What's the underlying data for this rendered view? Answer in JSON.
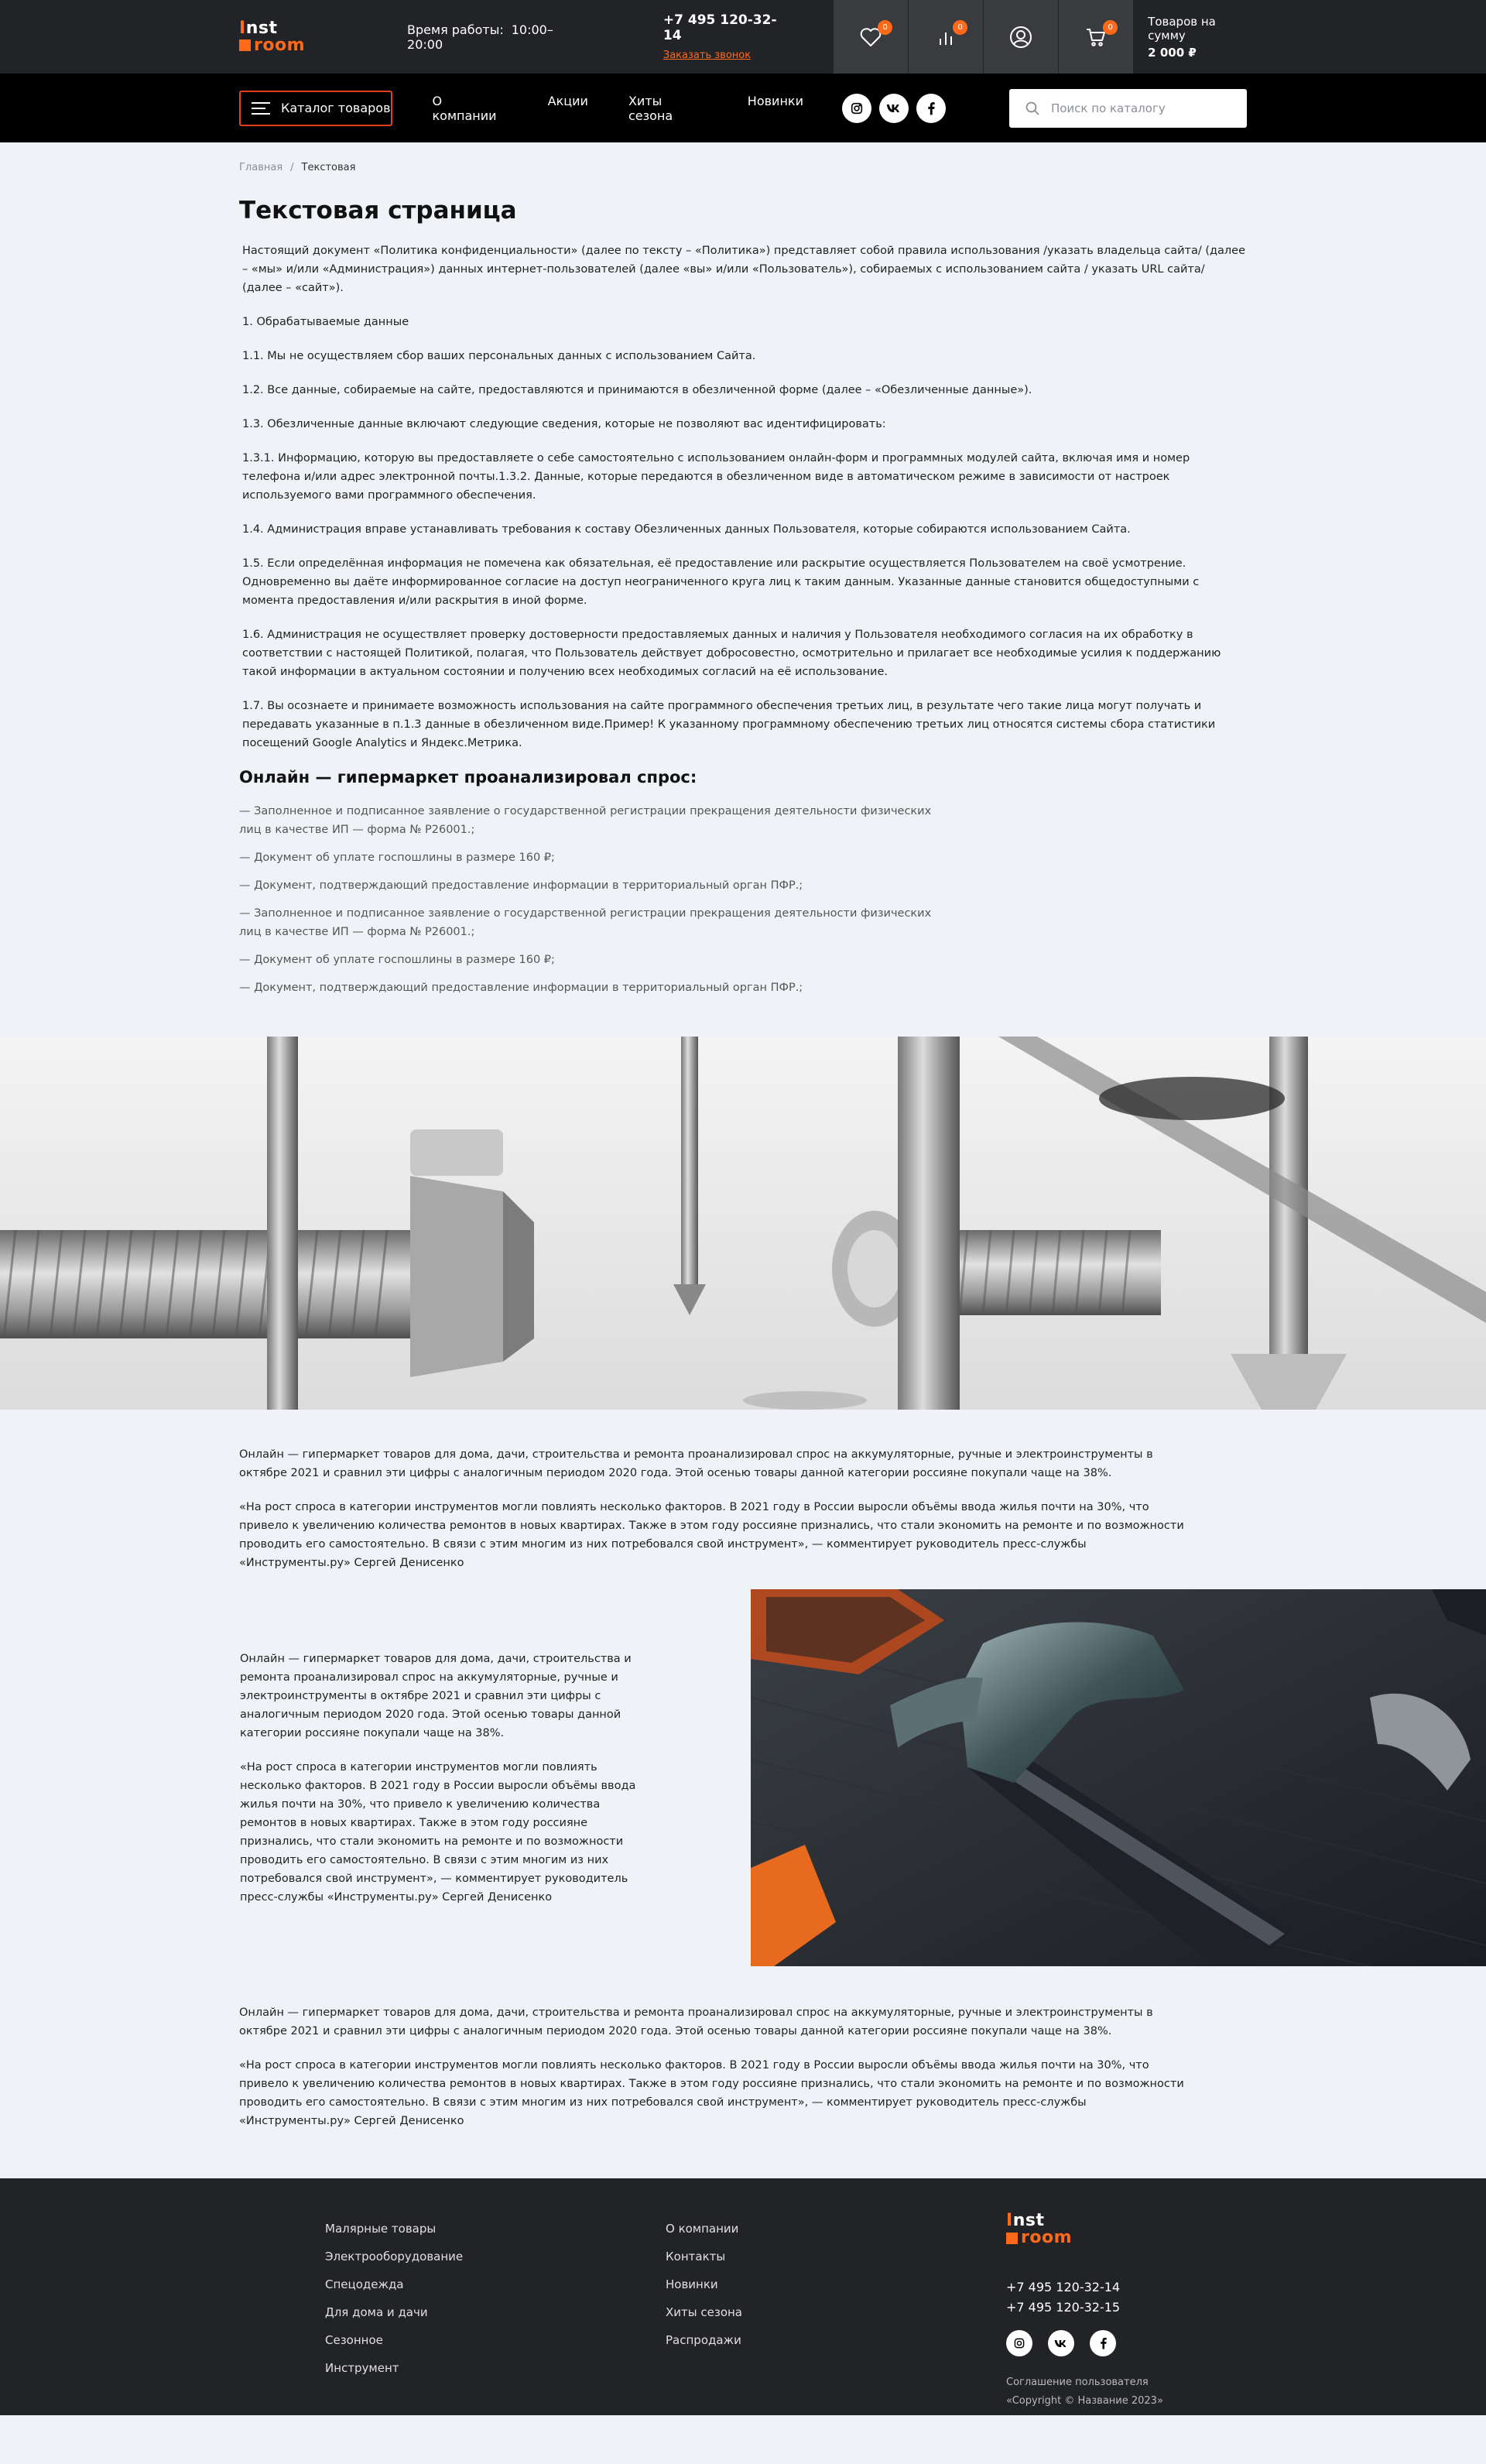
{
  "header": {
    "logo": {
      "line1_mark": "I",
      "line1_rest": "nst",
      "line2": "room"
    },
    "hours_label": "Время работы:",
    "hours_value": "10:00–20:00",
    "phone": "+7 495 120-32-14",
    "callback": "Заказать звонок",
    "badges": {
      "favorites": "0",
      "compare": "0",
      "cart": "0"
    },
    "cart_label": "Товаров на сумму",
    "cart_sum": "2 000 ₽"
  },
  "nav": {
    "catalog": "Каталог товаров",
    "links": [
      "О компании",
      "Акции",
      "Хиты сезона",
      "Новинки"
    ],
    "socials": [
      "instagram-icon",
      "vk-icon",
      "facebook-icon"
    ],
    "search_placeholder": "Поиск по каталогу"
  },
  "breadcrumb": {
    "home": "Главная",
    "sep": "/",
    "current": "Текстовая"
  },
  "page_title": "Текстовая страница",
  "article": {
    "paragraphs": [
      "Настоящий документ «Политика конфиденциальности» (далее по тексту – «Политика») представляет собой правила использования /указать владельца сайта/ (далее – «мы» и/или «Администрация») данных интернет-пользователей (далее «вы» и/или «Пользователь»), собираемых с использованием сайта / указать URL сайта/ (далее – «сайт»).",
      "1. Обрабатываемые данные",
      "1.1. Мы не осуществляем сбор ваших персональных данных с использованием Сайта.",
      "1.2. Все данные, собираемые на сайте, предоставляются и принимаются в обезличенной форме (далее – «Обезличенные данные»).",
      "1.3. Обезличенные данные включают следующие сведения, которые не позволяют вас идентифицировать:",
      "1.3.1. Информацию, которую вы предоставляете о себе самостоятельно с использованием онлайн-форм и программных модулей сайта, включая имя и номер телефона и/или адрес электронной почты.1.3.2. Данные, которые передаются в обезличенном виде в автоматическом режиме в зависимости от настроек используемого вами программного обеспечения.",
      "1.4. Администрация вправе устанавливать требования к составу Обезличенных данных Пользователя, которые собираются использованием Сайта.",
      "1.5. Если определённая информация не помечена как обязательная, её предоставление или раскрытие осуществляется Пользователем на своё усмотрение. Одновременно вы даёте информированное согласие на доступ неограниченного круга лиц к таким данным. Указанные данные становится общедоступными с момента предоставления и/или раскрытия в иной форме.",
      "1.6. Администрация не осуществляет проверку достоверности предоставляемых данных и наличия у Пользователя необходимого согласия на их обработку в соответствии с настоящей Политикой, полагая, что Пользователь действует добросовестно, осмотрительно и прилагает все необходимые усилия к поддержанию такой информации в актуальном состоянии и получению всех необходимых согласий на её использование.",
      "1.7. Вы осознаете и принимаете возможность использования на сайте программного обеспечения третьих лиц, в результате чего такие лица могут получать и передавать указанные в п.1.3 данные в обезличенном виде.Пример! К указанному программному обеспечению третьих лиц относятся системы сбора статистики посещений Google Analytics и Яндекс.Метрика."
    ],
    "section_title": "Онлайн — гипермаркет проанализировал спрос:",
    "list": [
      "— Заполненное и подписанное заявление о государственной регистрации прекращения деятельности физических лиц в качестве ИП — форма № Р26001.;",
      "— Документ об уплате госпошлины в размере 160 ₽;",
      "— Документ, подтверждающий предоставление информации в территориальный орган ПФР.;",
      "— Заполненное и подписанное заявление о государственной регистрации прекращения деятельности физических лиц в качестве ИП — форма № Р26001.;",
      "— Документ об уплате госпошлины в размере 160 ₽;",
      "— Документ, подтверждающий предоставление информации в территориальный орган ПФР.;"
    ]
  },
  "block1": [
    "Онлайн — гипермаркет товаров для дома, дачи, строительства и ремонта проанализировал спрос на аккумуляторные, ручные и электроинструменты в октябре 2021 и сравнил эти цифры с аналогичным периодом 2020 года. Этой осенью товары данной категории россияне покупали чаще на 38%.",
    "«На рост спроса в категории инструментов могли повлиять несколько факторов. В 2021 году в России выросли объёмы ввода жилья почти на 30%, что привело к увеличению количества ремонтов в новых квартирах. Также в этом году россияне признались, что стали экономить на ремонте и по возможности проводить его самостоятельно. В связи с этим многим из них потребовался свой инструмент», — комментирует руководитель пресс-службы «Инструменты.ру» Сергей Денисенко"
  ],
  "split": [
    "Онлайн — гипермаркет товаров для дома, дачи, строительства и ремонта проанализировал спрос на аккумуляторные, ручные и электроинструменты в октябре 2021 и сравнил эти цифры с аналогичным периодом 2020 года. Этой осенью товары данной категории россияне покупали чаще на 38%.",
    "«На рост спроса в категории инструментов могли повлиять несколько факторов. В 2021 году в России выросли объёмы ввода жилья почти на 30%, что привело к увеличению количества ремонтов в новых квартирах. Также в этом году россияне признались, что стали экономить на ремонте и по возможности проводить его самостоятельно. В связи с этим многим из них потребовался свой инструмент», — комментирует руководитель пресс-службы «Инструменты.ру» Сергей Денисенко"
  ],
  "block2": [
    "Онлайн — гипермаркет товаров для дома, дачи, строительства и ремонта проанализировал спрос на аккумуляторные, ручные и электроинструменты в октябре 2021 и сравнил эти цифры с аналогичным периодом 2020 года. Этой осенью товары данной категории россияне покупали чаще на 38%.",
    "«На рост спроса в категории инструментов могли повлиять несколько факторов. В 2021 году в России выросли объёмы ввода жилья почти на 30%, что привело к увеличению количества ремонтов в новых квартирах. Также в этом году россияне признались, что стали экономить на ремонте и по возможности проводить его самостоятельно. В связи с этим многим из них потребовался свой инструмент», — комментирует руководитель пресс-службы «Инструменты.ру» Сергей Денисенко"
  ],
  "footer": {
    "col1": [
      "Малярные товары",
      "Электрооборудование",
      "Спецодежда",
      "Для дома и дачи",
      "Сезонное",
      "Инструмент"
    ],
    "col2": [
      "О компании",
      "Контакты",
      "Новинки",
      "Хиты сезона",
      "Распродажи"
    ],
    "phones": [
      "+7 495 120-32-14",
      "+7 495 120-32-15"
    ],
    "agreement": "Соглашение пользователя",
    "copyright": "«Copyright © Название 2023»"
  },
  "colors": {
    "accent": "#ff6a1a",
    "header_bg": "#222326",
    "nav_bg": "#000000",
    "page_bg": "#eff3f7"
  }
}
